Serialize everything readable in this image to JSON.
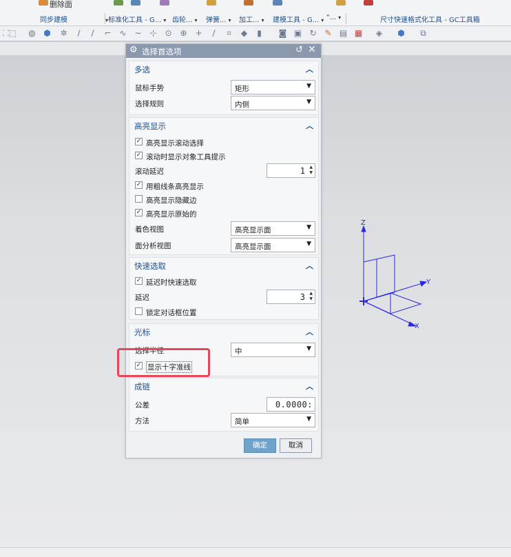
{
  "ribbon": {
    "top_command": "删除面",
    "groups": [
      "同步建模",
      "标准化工具 - G...",
      "齿轮...",
      "弹簧...",
      "加工...",
      "建模工具 - G...",
      "\"...",
      "尺寸快速格式化工具 - GC工具箱"
    ]
  },
  "dialog": {
    "title": "选择首选项",
    "sections": {
      "multi": {
        "title": "多选",
        "mouse_gesture_label": "鼠标手势",
        "mouse_gesture_value": "矩形",
        "select_rule_label": "选择规则",
        "select_rule_value": "内侧"
      },
      "highlight": {
        "title": "高亮显示",
        "rollover_label": "高亮显示滚动选择",
        "rollover_checked": true,
        "tooltip_label": "滚动时显示对象工具提示",
        "tooltip_checked": true,
        "delay_label": "滚动延迟",
        "delay_value": "1",
        "thick_label": "用粗线条高亮显示",
        "thick_checked": true,
        "hidden_edges_label": "高亮显示隐藏边",
        "hidden_edges_checked": false,
        "original_label": "高亮显示原始的",
        "original_checked": true,
        "shaded_view_label": "着色视图",
        "shaded_view_value": "高亮显示面",
        "face_analysis_label": "面分析视图",
        "face_analysis_value": "高亮显示面"
      },
      "quickpick": {
        "title": "快速选取",
        "delay_quickpick_label": "延迟时快速选取",
        "delay_quickpick_checked": true,
        "delay_label": "延迟",
        "delay_value": "3",
        "lock_pos_label": "锁定对话框位置",
        "lock_pos_checked": false
      },
      "cursor": {
        "title": "光标",
        "radius_label": "选择半径",
        "radius_value": "中",
        "crosshair_label": "显示十字准线",
        "crosshair_checked": true
      },
      "chaining": {
        "title": "成链",
        "tolerance_label": "公差",
        "tolerance_value": "0.0000:",
        "method_label": "方法",
        "method_value": "简单"
      }
    },
    "ok_label": "确定",
    "cancel_label": "取消"
  },
  "axes": {
    "z": "Z",
    "y": "Y",
    "x": "X",
    "color": "#2a2ad8"
  },
  "colors": {
    "highlight_box": "#e8475a",
    "ok_button": "#6fa3c9",
    "section_title": "#1f4f8c"
  }
}
